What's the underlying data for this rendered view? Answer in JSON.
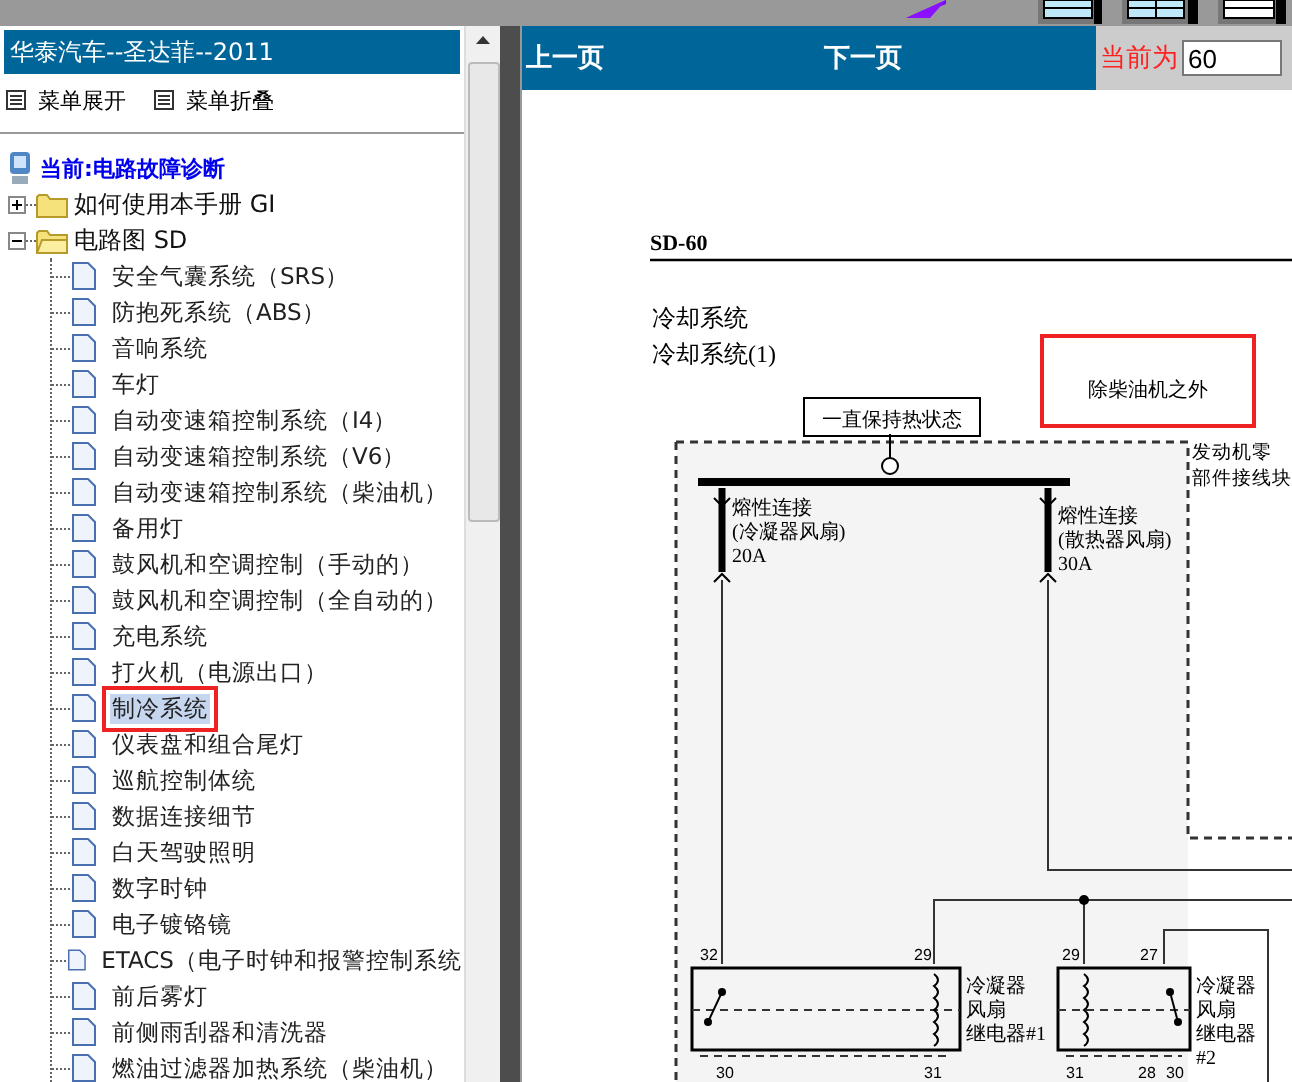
{
  "left_panel": {
    "title": "华泰汽车--圣达菲--2011",
    "menu": [
      {
        "label": "菜单展开"
      },
      {
        "label": "菜单折叠"
      }
    ],
    "current": "当前:电路故障诊断",
    "tree": [
      {
        "label": "如何使用本手册 GI",
        "expanded": false
      },
      {
        "label": "电路图 SD",
        "expanded": true,
        "children": [
          {
            "label": "安全气囊系统（SRS）",
            "selected": false
          },
          {
            "label": "防抱死系统（ABS）",
            "selected": false
          },
          {
            "label": "音响系统",
            "selected": false
          },
          {
            "label": "车灯",
            "selected": false
          },
          {
            "label": "自动变速箱控制系统（I4）",
            "selected": false
          },
          {
            "label": "自动变速箱控制系统（V6）",
            "selected": false
          },
          {
            "label": "自动变速箱控制系统（柴油机）",
            "selected": false
          },
          {
            "label": "备用灯",
            "selected": false
          },
          {
            "label": "鼓风机和空调控制（手动的）",
            "selected": false
          },
          {
            "label": "鼓风机和空调控制（全自动的）",
            "selected": false
          },
          {
            "label": "充电系统",
            "selected": false
          },
          {
            "label": "打火机（电源出口）",
            "selected": false
          },
          {
            "label": "制冷系统",
            "selected": true
          },
          {
            "label": "仪表盘和组合尾灯",
            "selected": false
          },
          {
            "label": "巡航控制体统",
            "selected": false
          },
          {
            "label": "数据连接细节",
            "selected": false
          },
          {
            "label": "白天驾驶照明",
            "selected": false
          },
          {
            "label": "数字时钟",
            "selected": false
          },
          {
            "label": "电子镀铬镜",
            "selected": false
          },
          {
            "label": "ETACS（电子时钟和报警控制系统",
            "selected": false
          },
          {
            "label": "前后雾灯",
            "selected": false
          },
          {
            "label": "前侧雨刮器和清洗器",
            "selected": false
          },
          {
            "label": "燃油过滤器加热系统（柴油机）",
            "selected": false
          }
        ]
      }
    ]
  },
  "viewer": {
    "prev": "上一页",
    "next": "下一页",
    "page_label": "当前为",
    "page_value": "60"
  },
  "document": {
    "code": "SD-60",
    "headings": [
      "冷却系统",
      "冷却系统(1)"
    ],
    "note": "除柴油机之外",
    "hot_label": "一直保持热状态",
    "block_label": [
      "发动机零",
      "部件接线块"
    ],
    "fuses": [
      {
        "lines": [
          "熔性连接",
          "(冷凝器风扇)"
        ],
        "rating": "20A"
      },
      {
        "lines": [
          "熔性连接",
          "(散热器风扇)"
        ],
        "rating": "30A"
      }
    ],
    "relays": [
      {
        "lines": [
          "冷凝器",
          "风扇",
          "继电器#1"
        ],
        "top_pins": [
          "32",
          "29"
        ],
        "bottom_pins": [
          "30",
          "31"
        ]
      },
      {
        "lines": [
          "冷凝器",
          "风扇",
          "继电器",
          "#2"
        ],
        "top_pins": [
          "29",
          "27"
        ],
        "bottom_pins": [
          "31",
          "28",
          "30"
        ]
      }
    ]
  }
}
